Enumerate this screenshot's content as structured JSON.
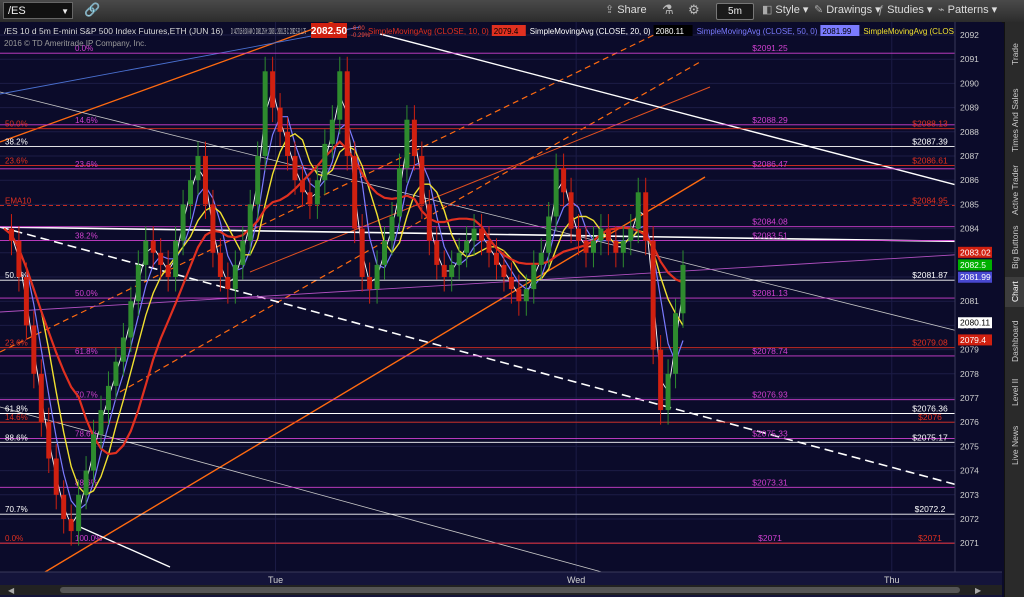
{
  "toolbar": {
    "symbol": "/ES",
    "share_label": "Share",
    "timeframe": "5m",
    "style_label": "Style",
    "drawings_label": "Drawings",
    "studies_label": "Studies",
    "patterns_label": "Patterns"
  },
  "header": {
    "info": "/ES 10 d 5m   E-mini S&P 500 Index Futures,ETH (JUN 16)",
    "ohlc": "D: 4/27/16 8:30 AM   O: 2081.25   H: 2083   L: 2081.25   C: 2082.5   R: 1.75",
    "price": "2082.50",
    "change": "-6.00",
    "change_pct": "-0.29%",
    "studies": [
      {
        "label": "SimpleMovingAvg (CLOSE, 10, 0)",
        "value": "2079.4",
        "color": "#e03020"
      },
      {
        "label": "SimpleMovingAvg (CLOSE, 20, 0)",
        "value": "2080.11",
        "color": "#ffffff"
      },
      {
        "label": "SimpleMovingAvg (CLOSE, 50, 0)",
        "value": "2081.99",
        "color": "#7b7bff"
      },
      {
        "label": "SimpleMovingAvg (CLOSE, 200, 0)",
        "value": "",
        "color": "#f0e030"
      }
    ],
    "copyright": "2016 © TD Ameritrade IP Company, Inc."
  },
  "axis": {
    "y_ticks": [
      "2092",
      "2091",
      "2090",
      "2089",
      "2088",
      "2087",
      "2086",
      "2085",
      "2084",
      "2083",
      "2082",
      "2081",
      "2080",
      "2079",
      "2078",
      "2077",
      "2076",
      "2075",
      "2074",
      "2073",
      "2072",
      "2071"
    ],
    "x_ticks": [
      {
        "label": "Tue",
        "pos": 0.275
      },
      {
        "label": "Wed",
        "pos": 0.575
      },
      {
        "label": "Thu",
        "pos": 0.89
      }
    ],
    "price_tags": [
      {
        "label": "2083.02",
        "value": 2083.02,
        "bg": "#d02010",
        "fg": "#ffffff"
      },
      {
        "label": "2082.5",
        "value": 2082.5,
        "bg": "#00b000",
        "fg": "#ffffff"
      },
      {
        "label": "2081.99",
        "value": 2081.99,
        "bg": "#4848d0",
        "fg": "#ffffff"
      },
      {
        "label": "2080.11",
        "value": 2080.11,
        "bg": "#ffffff",
        "fg": "#000000"
      },
      {
        "label": "2079.4",
        "value": 2079.4,
        "bg": "#d02010",
        "fg": "#ffffff"
      }
    ]
  },
  "levels": [
    {
      "price": 2091.25,
      "color": "#d040d0",
      "right": "$2091.25",
      "left": "0.0%",
      "left_color": "#d040d0",
      "lx": 75
    },
    {
      "price": 2088.29,
      "color": "#d040d0",
      "right": "$2088.29",
      "left": "14.6%",
      "left_color": "#d040d0",
      "lx": 75
    },
    {
      "price": 2088.13,
      "color": "#e03020",
      "right": "$2088.13",
      "left": "50.0%",
      "left_color": "#e03020",
      "lx": 5
    },
    {
      "price": 2087.39,
      "color": "#ffffff",
      "right": "$2087.39",
      "left": "38.2%",
      "left_color": "#ffffff",
      "lx": 5
    },
    {
      "price": 2086.61,
      "color": "#e03020",
      "right": "$2086.61",
      "left": "23.6%",
      "left_color": "#e03020",
      "lx": 5
    },
    {
      "price": 2086.47,
      "color": "#d040d0",
      "right": "$2086.47",
      "left": "23.6%",
      "left_color": "#d040d0",
      "lx": 75
    },
    {
      "price": 2084.95,
      "color": "#e03020",
      "right": "$2084.95",
      "left": "EMA10",
      "left_color": "#e03020",
      "lx": 5,
      "dash": true
    },
    {
      "price": 2084.08,
      "color": "#d040d0",
      "right": "$2084.08",
      "left": "",
      "left_color": "#d040d0",
      "lx": 5
    },
    {
      "price": 2083.51,
      "color": "#d040d0",
      "right": "$2083.51",
      "left": "38.2%",
      "left_color": "#d040d0",
      "lx": 75
    },
    {
      "price": 2081.87,
      "color": "#ffffff",
      "right": "$2081.87",
      "left": "50.0%",
      "left_color": "#ffffff",
      "lx": 5
    },
    {
      "price": 2081.13,
      "color": "#d040d0",
      "right": "$2081.13",
      "left": "50.0%",
      "left_color": "#d040d0",
      "lx": 75
    },
    {
      "price": 2079.08,
      "color": "#e03020",
      "right": "$2079.08",
      "left": "23.6%",
      "left_color": "#e03020",
      "lx": 5
    },
    {
      "price": 2078.74,
      "color": "#d040d0",
      "right": "$2078.74",
      "left": "61.8%",
      "left_color": "#d040d0",
      "lx": 75
    },
    {
      "price": 2076.93,
      "color": "#d040d0",
      "right": "$2076.93",
      "left": "70.7%",
      "left_color": "#d040d0",
      "lx": 75
    },
    {
      "price": 2076.36,
      "color": "#ffffff",
      "right": "$2076.36",
      "left": "61.8%",
      "left_color": "#ffffff",
      "lx": 5
    },
    {
      "price": 2076.0,
      "color": "#e03020",
      "right": "$2076",
      "left": "14.6%",
      "left_color": "#e03020",
      "lx": 5
    },
    {
      "price": 2075.33,
      "color": "#d040d0",
      "right": "$2075.33",
      "left": "78.6%",
      "left_color": "#d040d0",
      "lx": 75
    },
    {
      "price": 2075.17,
      "color": "#ffffff",
      "right": "$2075.17",
      "left": "88.6%",
      "left_color": "#ffffff",
      "lx": 5
    },
    {
      "price": 2073.31,
      "color": "#d040d0",
      "right": "$2073.31",
      "left": "88.6%",
      "left_color": "#d040d0",
      "lx": 75
    },
    {
      "price": 2072.2,
      "color": "#ffffff",
      "right": "$2072.2",
      "left": "70.7%",
      "left_color": "#ffffff",
      "lx": 5
    },
    {
      "price": 2071.0,
      "color": "#d040d0",
      "right": "$2071",
      "left": "100.0%",
      "left_color": "#d040d0",
      "lx": 75
    },
    {
      "price": 2071.0,
      "color": "#e03020",
      "right": "$2071",
      "left": "0.0%",
      "left_color": "#e03020",
      "lx": 5
    }
  ],
  "price_series": [
    2084.0,
    2083.5,
    2082.0,
    2080.0,
    2078.0,
    2076.0,
    2074.5,
    2073.0,
    2072.0,
    2071.5,
    2073.0,
    2074.0,
    2075.5,
    2076.5,
    2077.5,
    2078.5,
    2079.5,
    2081.0,
    2082.5,
    2083.5,
    2083.0,
    2082.5,
    2082.0,
    2083.5,
    2085.0,
    2086.0,
    2087.0,
    2085.0,
    2083.0,
    2082.0,
    2081.5,
    2082.5,
    2083.5,
    2085.0,
    2087.0,
    2090.5,
    2089.0,
    2088.0,
    2087.0,
    2086.0,
    2085.5,
    2085.0,
    2086.0,
    2087.5,
    2088.5,
    2090.5,
    2087.0,
    2084.0,
    2082.0,
    2081.5,
    2082.5,
    2083.5,
    2084.5,
    2086.5,
    2088.5,
    2087.0,
    2085.0,
    2083.5,
    2082.5,
    2082.0,
    2082.5,
    2083.0,
    2083.5,
    2084.0,
    2083.5,
    2083.0,
    2082.5,
    2082.0,
    2081.5,
    2081.0,
    2081.5,
    2082.5,
    2083.0,
    2084.5,
    2086.5,
    2085.5,
    2084.0,
    2083.5,
    2083.0,
    2083.5,
    2084.0,
    2083.5,
    2083.0,
    2083.5,
    2084.0,
    2085.5,
    2083.5,
    2079.0,
    2076.5,
    2078.0,
    2080.5,
    2082.5
  ],
  "side_tabs": [
    "Trade",
    "Times And Sales",
    "Active Trader",
    "Big Buttons",
    "Chart",
    "Dashboard",
    "Level II",
    "Live News"
  ],
  "colors": {
    "bg": "#0b0b2a",
    "up": "#2e8b2e",
    "down": "#d02010",
    "sma10": "#e03020",
    "sma20": "#ffffff",
    "sma50": "#7b7bff",
    "sma200": "#f0e030"
  }
}
